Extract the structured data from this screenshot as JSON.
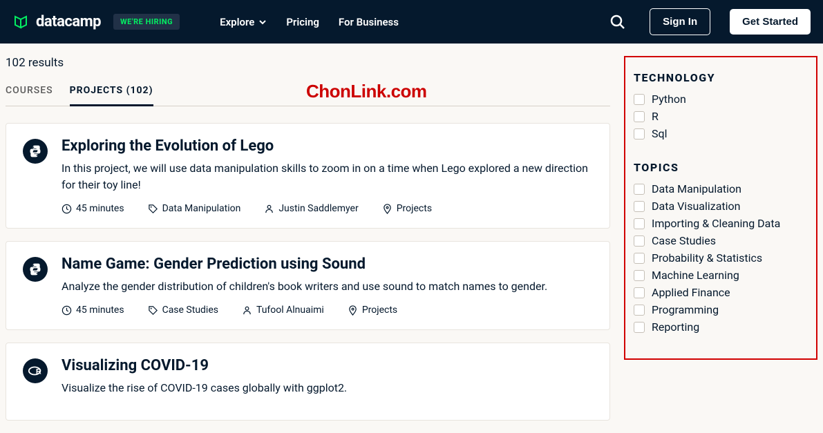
{
  "header": {
    "brand": "datacamp",
    "hiring": "WE'RE HIRING",
    "nav": {
      "explore": "Explore",
      "pricing": "Pricing",
      "business": "For Business"
    },
    "signin": "Sign In",
    "getstarted": "Get Started"
  },
  "results_count": "102 results",
  "tabs": {
    "courses": "COURSES",
    "projects": "PROJECTS (102)"
  },
  "watermark": "ChonLink.com",
  "cards": [
    {
      "icon": "python",
      "title": "Exploring the Evolution of Lego",
      "desc": "In this project, we will use data manipulation skills to zoom in on a time when Lego explored a new direction for their toy line!",
      "duration": "45 minutes",
      "tag": "Data Manipulation",
      "author": "Justin Saddlemyer",
      "type": "Projects"
    },
    {
      "icon": "python",
      "title": "Name Game: Gender Prediction using Sound",
      "desc": "Analyze the gender distribution of children's book writers and use sound to match names to gender.",
      "duration": "45 minutes",
      "tag": "Case Studies",
      "author": "Tufool Alnuaimi",
      "type": "Projects"
    },
    {
      "icon": "r",
      "title": "Visualizing COVID-19",
      "desc": "Visualize the rise of COVID-19 cases globally with ggplot2."
    }
  ],
  "filters": {
    "tech_title": "TECHNOLOGY",
    "tech": [
      "Python",
      "R",
      "Sql"
    ],
    "topics_title": "TOPICS",
    "topics": [
      "Data Manipulation",
      "Data Visualization",
      "Importing & Cleaning Data",
      "Case Studies",
      "Probability & Statistics",
      "Machine Learning",
      "Applied Finance",
      "Programming",
      "Reporting"
    ]
  }
}
